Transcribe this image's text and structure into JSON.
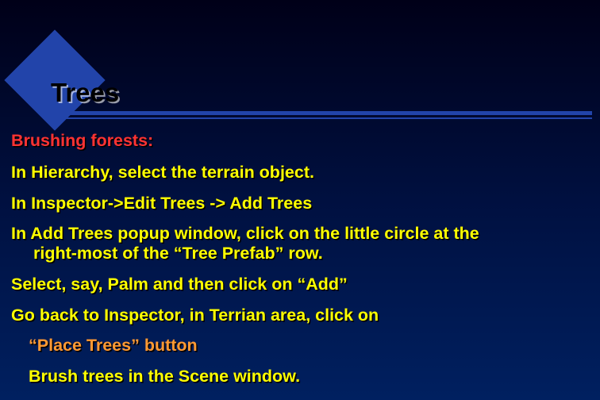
{
  "slide": {
    "title": "Trees",
    "subtitle": "Brushing forests:",
    "lines": {
      "l1": "In Hierarchy, select the terrain object.",
      "l2": "In Inspector->Edit Trees -> Add Trees",
      "l3a": "In Add Trees  popup window, click on the little circle at the",
      "l3b": "right-most of the “Tree Prefab” row.",
      "l4": "Select, say, Palm and then click on “Add”",
      "l5": "Go back to Inspector, in Terrian area, click on",
      "l6": "“Place Trees” button",
      "l7": "Brush trees in the Scene window."
    }
  }
}
